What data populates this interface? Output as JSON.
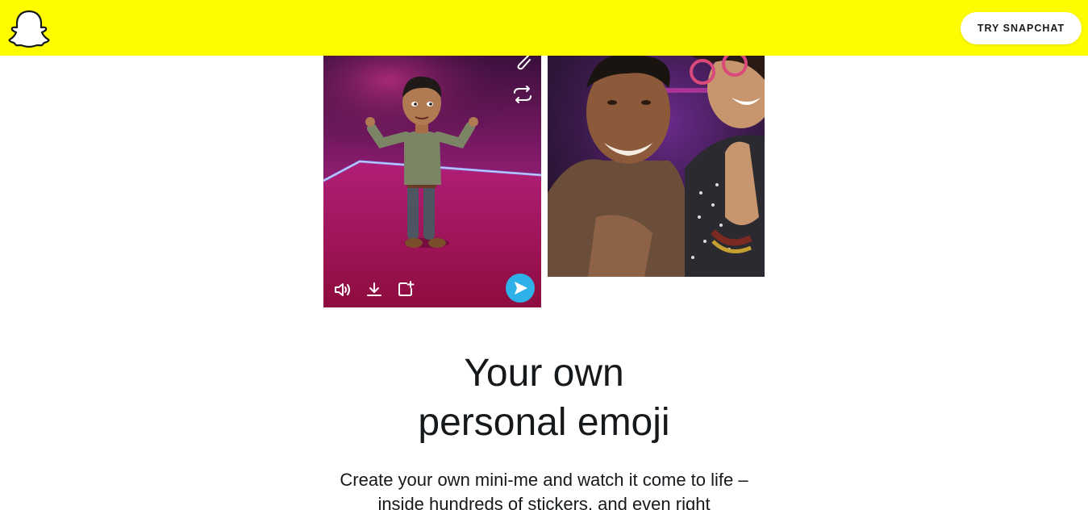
{
  "header": {
    "logo_icon": "snapchat-ghost-icon",
    "cta_label": "TRY SNAPCHAT",
    "brand_color": "#FFFC00"
  },
  "phone_preview": {
    "top_icons": [
      "attachment-icon",
      "loop-icon"
    ],
    "bottom_icons": [
      "volume-icon",
      "download-icon",
      "add-to-story-icon"
    ],
    "send_icon": "send-arrow-icon",
    "send_color": "#2eb1e8"
  },
  "photo_preview": {
    "description_icon": "friends-photo"
  },
  "section": {
    "headline_line1": "Your own",
    "headline_line2": "personal emoji",
    "body": "Create your own mini-me and watch it come to life – inside hundreds of stickers, and even right"
  }
}
